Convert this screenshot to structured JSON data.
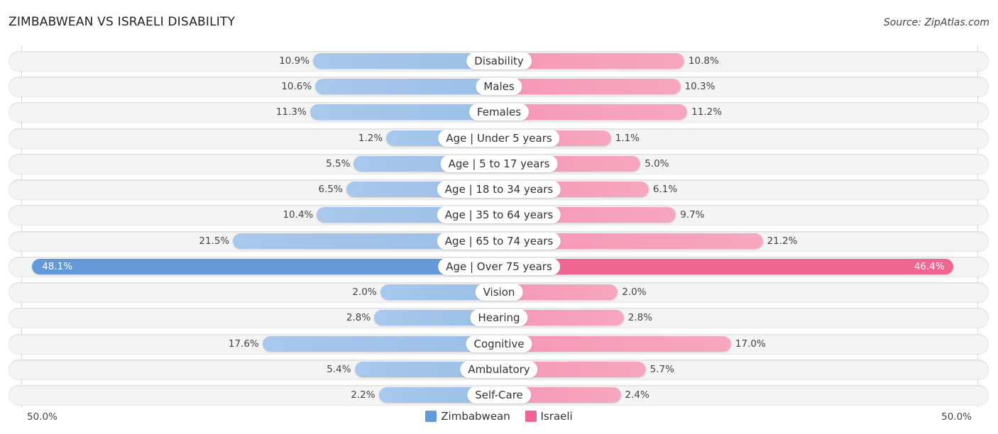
{
  "header": {
    "title": "ZIMBABWEAN VS ISRAELI DISABILITY",
    "source": "Source: ZipAtlas.com"
  },
  "colors": {
    "zimbabwean_strong": "#6499d9",
    "zimbabwean_light": "#a8c8ec",
    "israeli_strong": "#f06693",
    "israeli_light": "#f7a7c0"
  },
  "chart_data": {
    "type": "bar",
    "orientation": "horizontal-diverging",
    "title": "ZIMBABWEAN VS ISRAELI DISABILITY",
    "categories": [
      "Disability",
      "Males",
      "Females",
      "Age | Under 5 years",
      "Age | 5 to 17 years",
      "Age | 18 to 34 years",
      "Age | 35 to 64 years",
      "Age | 65 to 74 years",
      "Age | Over 75 years",
      "Vision",
      "Hearing",
      "Cognitive",
      "Ambulatory",
      "Self-Care"
    ],
    "series": [
      {
        "name": "Zimbabwean",
        "side": "left",
        "values": [
          10.9,
          10.6,
          11.3,
          1.2,
          5.5,
          6.5,
          10.4,
          21.5,
          48.1,
          2.0,
          2.8,
          17.6,
          5.4,
          2.2
        ],
        "labels": [
          "10.9%",
          "10.6%",
          "11.3%",
          "1.2%",
          "5.5%",
          "6.5%",
          "10.4%",
          "21.5%",
          "48.1%",
          "2.0%",
          "2.8%",
          "17.6%",
          "5.4%",
          "2.2%"
        ]
      },
      {
        "name": "Israeli",
        "side": "right",
        "values": [
          10.8,
          10.3,
          11.2,
          1.1,
          5.0,
          6.1,
          9.7,
          21.2,
          46.4,
          2.0,
          2.8,
          17.0,
          5.7,
          2.4
        ],
        "labels": [
          "10.8%",
          "10.3%",
          "11.2%",
          "1.1%",
          "5.0%",
          "6.1%",
          "9.7%",
          "21.2%",
          "46.4%",
          "2.0%",
          "2.8%",
          "17.0%",
          "5.7%",
          "2.4%"
        ]
      }
    ],
    "axis": {
      "left_label": "50.0%",
      "right_label": "50.0%",
      "max": 50.0
    },
    "legend": {
      "position": "bottom-center",
      "entries": [
        "Zimbabwean",
        "Israeli"
      ]
    },
    "grid": false
  }
}
